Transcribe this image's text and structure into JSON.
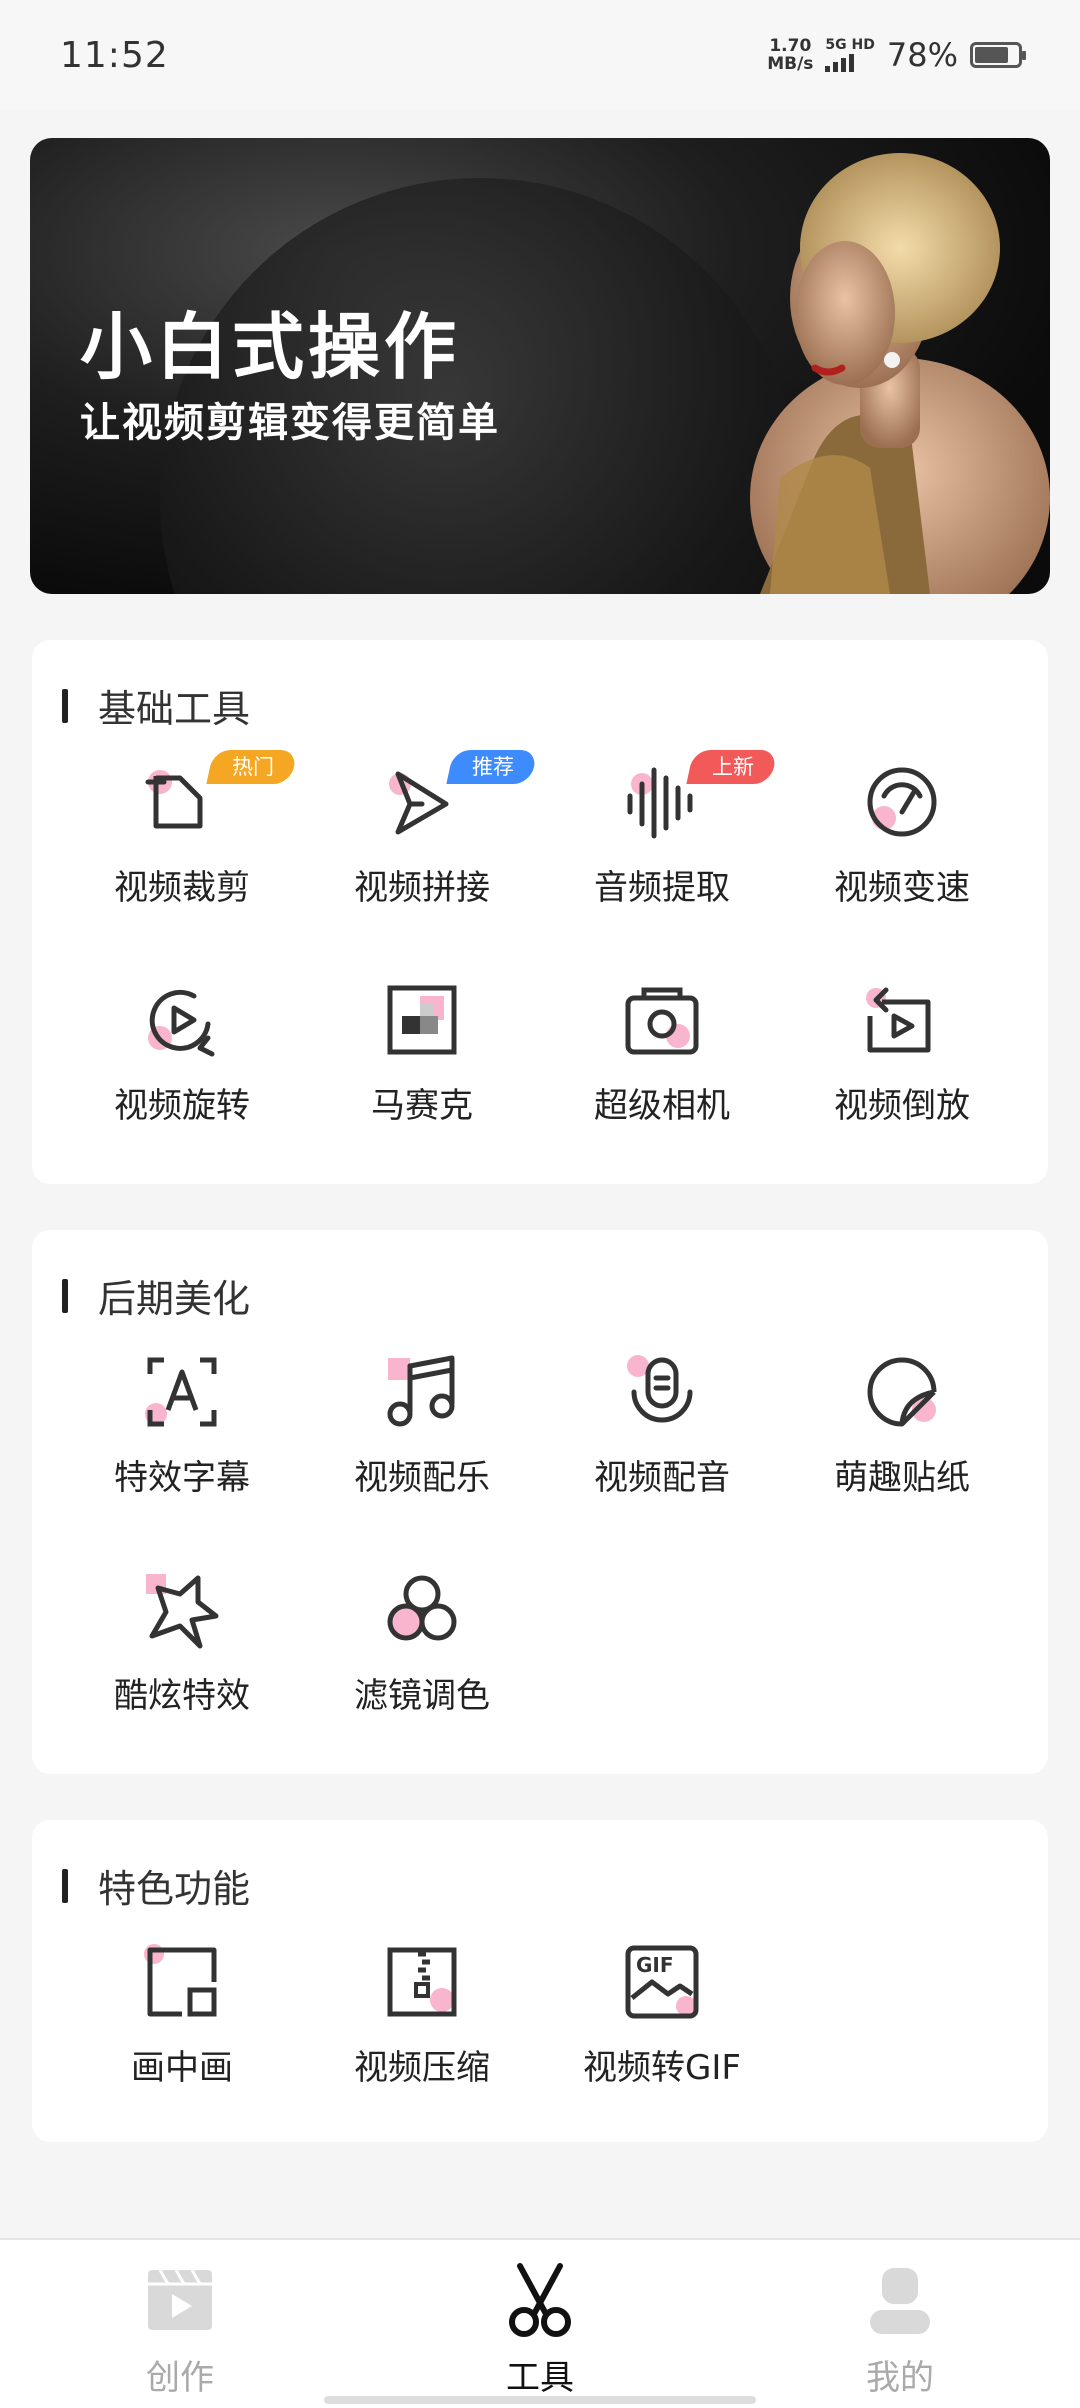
{
  "status_bar": {
    "time": "11:52",
    "net_speed_value": "1.70",
    "net_speed_unit": "MB/s",
    "network": "5G HD",
    "battery": "78%",
    "battery_level": 0.78
  },
  "banner": {
    "title": "小白式操作",
    "subtitle": "让视频剪辑变得更简单"
  },
  "sections": [
    {
      "title": "基础工具",
      "tools": [
        {
          "label": "视频裁剪",
          "icon": "crop-file-icon",
          "badge": "热门",
          "badge_color": "#f5a623"
        },
        {
          "label": "视频拼接",
          "icon": "play-split-icon",
          "badge": "推荐",
          "badge_color": "#3d8bfd"
        },
        {
          "label": "音频提取",
          "icon": "waveform-icon",
          "badge": "上新",
          "badge_color": "#f25a5a"
        },
        {
          "label": "视频变速",
          "icon": "speedometer-icon"
        },
        {
          "label": "视频旋转",
          "icon": "rotate-play-icon"
        },
        {
          "label": "马赛克",
          "icon": "mosaic-icon"
        },
        {
          "label": "超级相机",
          "icon": "camera-icon"
        },
        {
          "label": "视频倒放",
          "icon": "reverse-play-icon"
        }
      ]
    },
    {
      "title": "后期美化",
      "tools": [
        {
          "label": "特效字幕",
          "icon": "subtitle-icon"
        },
        {
          "label": "视频配乐",
          "icon": "music-note-icon"
        },
        {
          "label": "视频配音",
          "icon": "microphone-icon"
        },
        {
          "label": "萌趣贴纸",
          "icon": "sticker-icon"
        },
        {
          "label": "酷炫特效",
          "icon": "star-effect-icon"
        },
        {
          "label": "滤镜调色",
          "icon": "filter-circles-icon"
        }
      ]
    },
    {
      "title": "特色功能",
      "tools": [
        {
          "label": "画中画",
          "icon": "picture-in-picture-icon"
        },
        {
          "label": "视频压缩",
          "icon": "zip-compress-icon"
        },
        {
          "label": "视频转GIF",
          "icon": "gif-icon"
        }
      ]
    }
  ],
  "bottom_nav": [
    {
      "label": "创作",
      "icon": "clapperboard-icon",
      "active": false
    },
    {
      "label": "工具",
      "icon": "scissors-icon",
      "active": true
    },
    {
      "label": "我的",
      "icon": "user-icon",
      "active": false
    }
  ],
  "colors": {
    "accent_pink": "#f7a8c4",
    "icon_stroke": "#333333",
    "card_bg": "#ffffff",
    "page_bg": "#f5f5f6"
  }
}
